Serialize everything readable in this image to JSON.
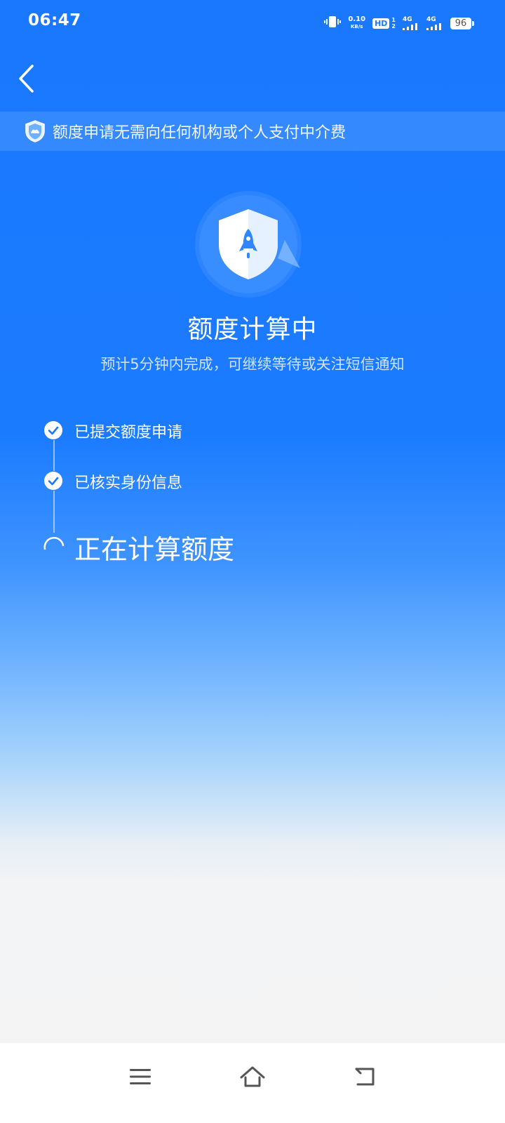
{
  "status_bar": {
    "time": "06:47",
    "net_speed_value": "0.10",
    "net_speed_unit": "KB/s",
    "hd_label": "HD",
    "sim_nums": [
      "1",
      "2"
    ],
    "sim1_network": "4G",
    "sim2_network": "4G",
    "battery": "96",
    "icons": [
      "vibrate-icon",
      "hd-icon",
      "signal-icon",
      "battery-icon"
    ]
  },
  "header": {
    "back_icon": "chevron-left-icon"
  },
  "notice": {
    "icon": "shield-icon",
    "text": "额度申请无需向任何机构或个人支付中介费"
  },
  "hero": {
    "icon": "rocket-shield-icon",
    "title": "额度计算中",
    "subtitle": "预计5分钟内完成，可继续等待或关注短信通知"
  },
  "steps": [
    {
      "label": "已提交额度申请",
      "status": "done",
      "icon": "check-icon"
    },
    {
      "label": "已核实身份信息",
      "status": "done",
      "icon": "check-icon"
    },
    {
      "label": "正在计算额度",
      "status": "in-progress",
      "icon": "spinner-icon"
    }
  ],
  "nav_bar": {
    "buttons": [
      "menu-icon",
      "home-icon",
      "back-icon"
    ]
  },
  "colors": {
    "primary": "#1a78ff",
    "background_bottom": "#f4f4f5",
    "text": "#ffffff"
  }
}
